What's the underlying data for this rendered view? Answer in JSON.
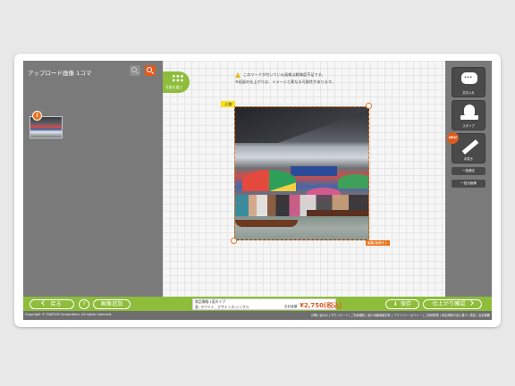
{
  "left_panel": {
    "title": "アップロード画像 1コマ",
    "thumbnail_badge": "!"
  },
  "layout_button": {
    "label": "写真を選ぶ"
  },
  "notices": [
    "このマークが付いている画像は解像度不足です。",
    "※画面の仕上がりは、イメージと異なる可能性があります。"
  ],
  "photo": {
    "label": "人物",
    "edit_tag": "編集/画像をト"
  },
  "tools": [
    {
      "label": "文字入れ",
      "icon": "speech-bubble-icon"
    },
    {
      "label": "スタンプ",
      "icon": "stamp-icon"
    },
    {
      "label": "手書き",
      "icon": "pen-icon",
      "badge": "NEW"
    }
  ],
  "side_buttons": [
    "一括補正",
    "一括元画像"
  ],
  "bottom": {
    "back": "戻る",
    "help": "?",
    "add_image": "画像追加",
    "save": "保存",
    "confirm": "仕上がり確認"
  },
  "product_info": {
    "line1": "商品情報:1面タイプ",
    "line2": "表: ホワイト、デザインホ:シングル",
    "price_label": "合計金額",
    "price": "¥2,750(税込)"
  },
  "footer": {
    "copyright": "Copyright © FUJIFILM Corporation. All rights reserved.",
    "links": "お問い合わせ | ダウンロード | ご利用規約 | 個人情報保護方針 | プライバシーポリシー | ご利用環境 | 特定商取引法に基づく表記 | 会社概要"
  },
  "colors": {
    "accent_green": "#8dbd3a",
    "accent_orange": "#e05a1e",
    "panel_gray": "#7a7a7a"
  }
}
